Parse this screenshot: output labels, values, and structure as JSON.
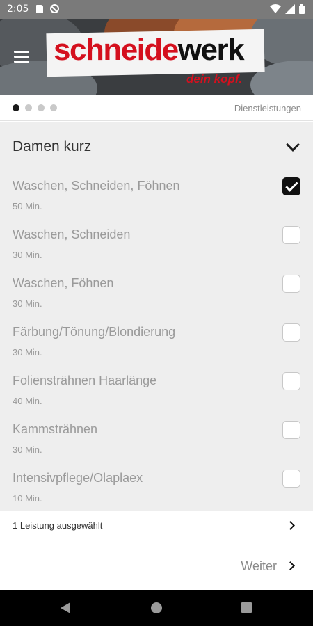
{
  "status_bar": {
    "time": "2:05"
  },
  "banner": {
    "logo_red": "schneide",
    "logo_black": "werk",
    "logo_tagline": "dein kopf."
  },
  "pager": {
    "page_count": 4,
    "active_index": 0,
    "label": "Dienstleistungen"
  },
  "category": {
    "title": "Damen kurz"
  },
  "services": [
    {
      "name": "Waschen, Schneiden, Föhnen",
      "duration": "50 Min.",
      "selected": true
    },
    {
      "name": "Waschen, Schneiden",
      "duration": "30 Min.",
      "selected": false
    },
    {
      "name": "Waschen, Föhnen",
      "duration": "30 Min.",
      "selected": false
    },
    {
      "name": "Färbung/Tönung/Blondierung",
      "duration": "30 Min.",
      "selected": false
    },
    {
      "name": "Foliensträhnen Haarlänge",
      "duration": "40 Min.",
      "selected": false
    },
    {
      "name": "Kammsträhnen",
      "duration": "30 Min.",
      "selected": false
    },
    {
      "name": "Intensivpflege/Olaplaex",
      "duration": "10 Min.",
      "selected": false
    }
  ],
  "summary": {
    "text": "1 Leistung ausgewählt"
  },
  "footer": {
    "next_label": "Weiter"
  },
  "colors": {
    "brand_red": "#d4101e",
    "list_bg": "#eeeeee",
    "status_bar": "#7a7a7a"
  }
}
